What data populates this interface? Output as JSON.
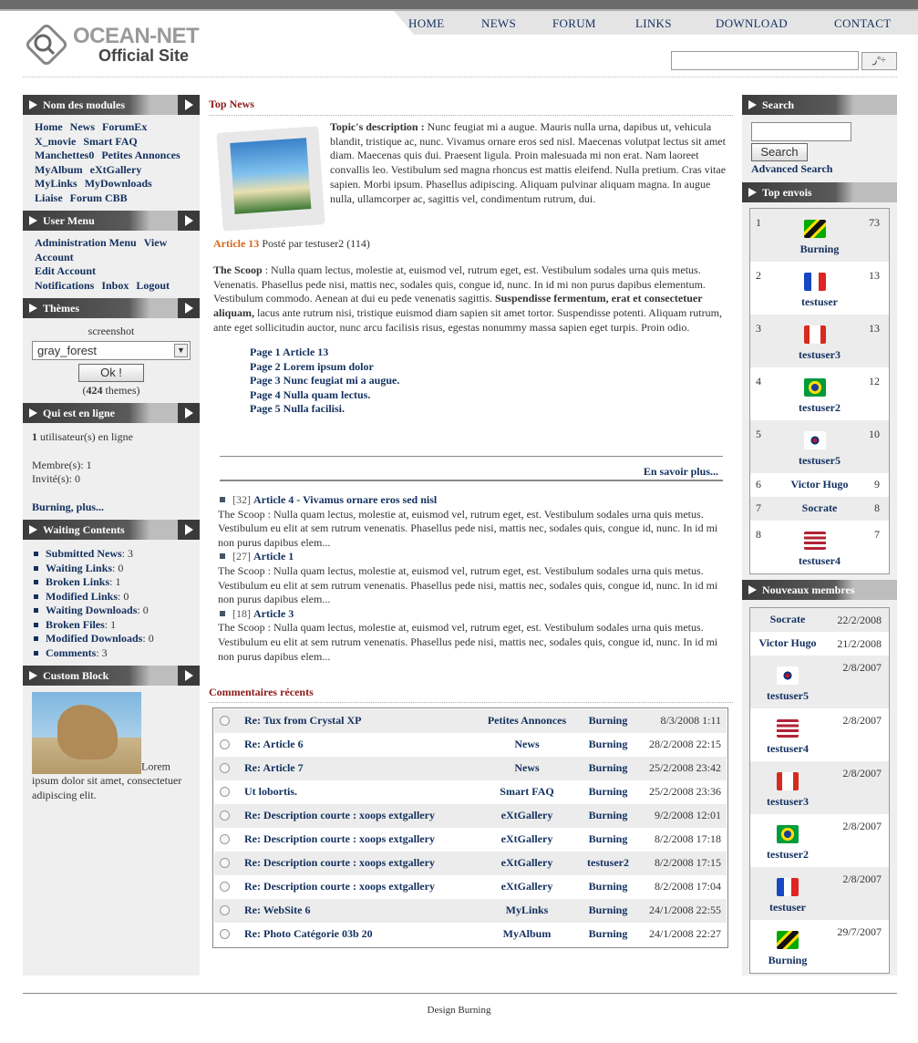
{
  "header": {
    "logo_line1": "OCEAN-NET",
    "logo_line2": "Official Site",
    "nav": [
      "HOME",
      "NEWS",
      "FORUM",
      "LINKS",
      "DOWNLOAD",
      "CONTACT"
    ],
    "search_button": "ر°÷"
  },
  "left": {
    "modules": {
      "title": "Nom des modules",
      "items": [
        "Home",
        "News",
        "ForumEx",
        "X_movie",
        "Smart FAQ",
        "Manchettes0",
        "Petites Annonces",
        "MyAlbum",
        "eXtGallery",
        "MyLinks",
        "MyDownloads",
        "Liaise",
        "Forum CBB"
      ]
    },
    "usermenu": {
      "title": "User Menu",
      "items": [
        "Administration Menu",
        "View Account",
        "Edit Account",
        "Notifications",
        "Inbox",
        "Logout"
      ]
    },
    "themes": {
      "title": "Thèmes",
      "label": "screenshot",
      "selected": "gray_forest",
      "button": "Ok !",
      "count": "424",
      "count_suffix": "themes)"
    },
    "online": {
      "title": "Qui est en ligne",
      "users_count": "1",
      "users_text": "utilisateur(s) en ligne",
      "members": "Membre(s): 1",
      "guests": "Invité(s): 0",
      "more": "Burning, plus..."
    },
    "waiting": {
      "title": "Waiting Contents",
      "items": [
        {
          "label": "Submitted News",
          "value": ": 3"
        },
        {
          "label": "Waiting Links",
          "value": ": 0"
        },
        {
          "label": "Broken Links",
          "value": ": 1"
        },
        {
          "label": "Modified Links",
          "value": ": 0"
        },
        {
          "label": "Waiting Downloads",
          "value": ": 0"
        },
        {
          "label": "Broken Files",
          "value": ": 1"
        },
        {
          "label": "Modified Downloads",
          "value": ": 0"
        },
        {
          "label": "Comments",
          "value": ": 3"
        }
      ]
    },
    "custom": {
      "title": "Custom Block",
      "text": "Lorem ipsum dolor sit amet, consectetuer adipiscing elit."
    }
  },
  "center": {
    "top_news": "Top News",
    "topic_label": "Topic's description :",
    "topic_text": "Nunc feugiat mi a augue. Mauris nulla urna, dapibus ut, vehicula blandit, tristique ac, nunc. Vivamus ornare eros sed nisl. Maecenas volutpat lectus sit amet diam. Maecenas quis dui. Praesent ligula. Proin malesuada mi non erat. Nam laoreet convallis leo. Vestibulum sed magna rhoncus est mattis eleifend. Nulla pretium. Cras vitae sapien. Morbi ipsum. Phasellus adipiscing. Aliquam pulvinar aliquam magna. In augue nulla, ullamcorper ac, sagittis vel, condimentum rutrum, dui.",
    "article_link": "Article 13",
    "article_meta": "Posté par testuser2 (114)",
    "scoop_label": "The Scoop",
    "scoop_text1": ": Nulla quam lectus, molestie at, euismod vel, rutrum eget, est. Vestibulum sodales urna quis metus. Venenatis. Phasellus pede nisi, mattis nec, sodales quis, congue id, nunc. In id mi non purus dapibus elementum. Vestibulum commodo. Aenean at dui eu pede venenatis sagittis.",
    "scoop_bold": "Suspendisse fermentum, erat et consectetuer aliquam,",
    "scoop_text2": "lacus ante rutrum nisi, tristique euismod diam sapien sit amet tortor. Suspendisse potenti. Aliquam rutrum, ante eget sollicitudin auctor, nunc arcu facilisis risus, egestas nonummy massa sapien eget turpis. Proin odio.",
    "pages": [
      "Page 1 Article 13",
      "Page 2 Lorem ipsum dolor",
      "Page 3 Nunc feugiat mi a augue.",
      "Page 4 Nulla quam lectus.",
      "Page 5 Nulla facilisi."
    ],
    "read_more": "En savoir plus...",
    "news": [
      {
        "count": "[32]",
        "title": "Article 4 - Vivamus ornare eros sed nisl",
        "text": "The Scoop : Nulla quam lectus, molestie at, euismod vel, rutrum eget, est. Vestibulum sodales urna quis metus. Vestibulum eu elit at sem rutrum venenatis. Phasellus pede nisi, mattis nec, sodales quis, congue id, nunc. In id mi non purus dapibus elem..."
      },
      {
        "count": "[27]",
        "title": "Article 1",
        "text": "The Scoop : Nulla quam lectus, molestie at, euismod vel, rutrum eget, est. Vestibulum sodales urna quis metus. Vestibulum eu elit at sem rutrum venenatis. Phasellus pede nisi, mattis nec, sodales quis, congue id, nunc. In id mi non purus dapibus elem..."
      },
      {
        "count": "[18]",
        "title": "Article 3",
        "text": "The Scoop : Nulla quam lectus, molestie at, euismod vel, rutrum eget, est. Vestibulum sodales urna quis metus. Vestibulum eu elit at sem rutrum venenatis. Phasellus pede nisi, mattis nec, sodales quis, congue id, nunc. In id mi non purus dapibus elem..."
      }
    ],
    "comments_title": "Commentaires récents",
    "comments": [
      {
        "title": "Re: Tux from Crystal XP",
        "module": "Petites Annonces",
        "user": "Burning",
        "date": "8/3/2008 1:11"
      },
      {
        "title": "Re: Article 6",
        "module": "News",
        "user": "Burning",
        "date": "28/2/2008 22:15"
      },
      {
        "title": "Re: Article 7",
        "module": "News",
        "user": "Burning",
        "date": "25/2/2008 23:42"
      },
      {
        "title": "Ut lobortis.",
        "module": "Smart FAQ",
        "user": "Burning",
        "date": "25/2/2008 23:36"
      },
      {
        "title": "Re: Description courte : xoops extgallery",
        "module": "eXtGallery",
        "user": "Burning",
        "date": "9/2/2008 12:01"
      },
      {
        "title": "Re: Description courte : xoops extgallery",
        "module": "eXtGallery",
        "user": "Burning",
        "date": "8/2/2008 17:18"
      },
      {
        "title": "Re: Description courte : xoops extgallery",
        "module": "eXtGallery",
        "user": "testuser2",
        "date": "8/2/2008 17:15"
      },
      {
        "title": "Re: Description courte : xoops extgallery",
        "module": "eXtGallery",
        "user": "Burning",
        "date": "8/2/2008 17:04"
      },
      {
        "title": "Re: WebSite 6",
        "module": "MyLinks",
        "user": "Burning",
        "date": "24/1/2008 22:55"
      },
      {
        "title": "Re: Photo Catégorie 03b 20",
        "module": "MyAlbum",
        "user": "Burning",
        "date": "24/1/2008 22:27"
      }
    ]
  },
  "right": {
    "search": {
      "title": "Search",
      "button": "Search",
      "advanced": "Advanced Search"
    },
    "top": {
      "title": "Top envois",
      "rows": [
        {
          "rank": "1",
          "name": "Burning",
          "count": "73",
          "flag": "jamaica-flag-icon"
        },
        {
          "rank": "2",
          "name": "testuser",
          "count": "13",
          "flag": "france-flag-icon"
        },
        {
          "rank": "3",
          "name": "testuser3",
          "count": "13",
          "flag": "canada-flag-icon"
        },
        {
          "rank": "4",
          "name": "testuser2",
          "count": "12",
          "flag": "brazil-flag-icon"
        },
        {
          "rank": "5",
          "name": "testuser5",
          "count": "10",
          "flag": "korea-flag-icon"
        },
        {
          "rank": "6",
          "name": "Victor Hugo",
          "count": "9",
          "flag": ""
        },
        {
          "rank": "7",
          "name": "Socrate",
          "count": "8",
          "flag": ""
        },
        {
          "rank": "8",
          "name": "testuser4",
          "count": "7",
          "flag": "usa-flag-icon"
        }
      ]
    },
    "newmembers": {
      "title": "Nouveaux membres",
      "rows": [
        {
          "name": "Socrate",
          "date": "22/2/2008",
          "flag": ""
        },
        {
          "name": "Victor Hugo",
          "date": "21/2/2008",
          "flag": ""
        },
        {
          "name": "testuser5",
          "date": "2/8/2007",
          "flag": "korea-flag-icon"
        },
        {
          "name": "testuser4",
          "date": "2/8/2007",
          "flag": "usa-flag-icon"
        },
        {
          "name": "testuser3",
          "date": "2/8/2007",
          "flag": "canada-flag-icon"
        },
        {
          "name": "testuser2",
          "date": "2/8/2007",
          "flag": "brazil-flag-icon"
        },
        {
          "name": "testuser",
          "date": "2/8/2007",
          "flag": "france-flag-icon"
        },
        {
          "name": "Burning",
          "date": "29/7/2007",
          "flag": "jamaica-flag-icon"
        }
      ]
    }
  },
  "footer": {
    "text": "Design Burning"
  }
}
